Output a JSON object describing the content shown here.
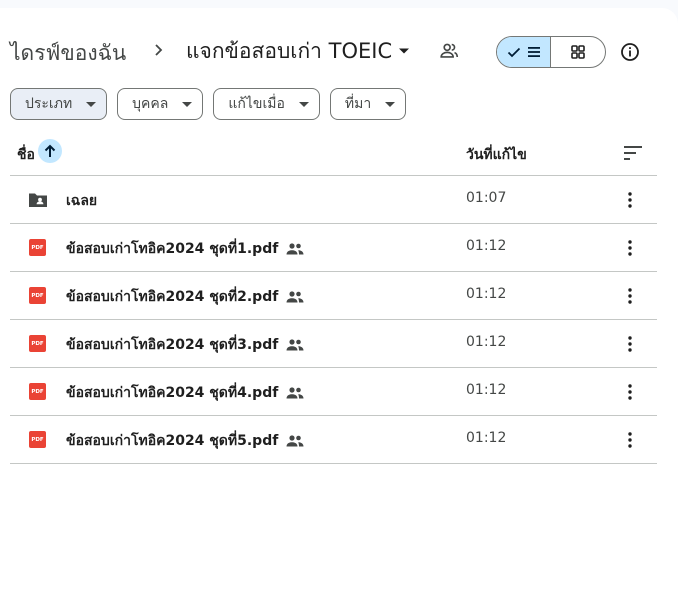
{
  "breadcrumb": {
    "root": "ไดรฟ์ของฉัน",
    "current": "แจกข้อสอบเก่า TOEIC"
  },
  "view": {
    "list_icon": "check-list-icon",
    "grid_icon": "grid-icon",
    "selected": "list"
  },
  "filters": [
    {
      "label": "ประเภท"
    },
    {
      "label": "บุคคล"
    },
    {
      "label": "แก้ไขเมื่อ"
    },
    {
      "label": "ที่มา"
    }
  ],
  "table": {
    "columns": {
      "name": "ชื่อ",
      "modified": "วันที่แก้ไข"
    },
    "rows": [
      {
        "name": "เฉลย",
        "type": "folder",
        "modified": "01:07",
        "shared": false
      },
      {
        "name": "ข้อสอบเก่าโทอิค2024 ชุดที่1.pdf",
        "type": "pdf",
        "modified": "01:12",
        "shared": true
      },
      {
        "name": "ข้อสอบเก่าโทอิค2024 ชุดที่2.pdf",
        "type": "pdf",
        "modified": "01:12",
        "shared": true
      },
      {
        "name": "ข้อสอบเก่าโทอิค2024 ชุดที่3.pdf",
        "type": "pdf",
        "modified": "01:12",
        "shared": true
      },
      {
        "name": "ข้อสอบเก่าโทอิค2024 ชุดที่4.pdf",
        "type": "pdf",
        "modified": "01:12",
        "shared": true
      },
      {
        "name": "ข้อสอบเก่าโทอิค2024 ชุดที่5.pdf",
        "type": "pdf",
        "modified": "01:12",
        "shared": true
      }
    ]
  },
  "icons": {
    "pdf_label": "PDF"
  },
  "colors": {
    "accent": "#c2e7ff",
    "pdf_red": "#ea4335",
    "text": "#1f1f1f",
    "border": "#c4c7c5"
  }
}
